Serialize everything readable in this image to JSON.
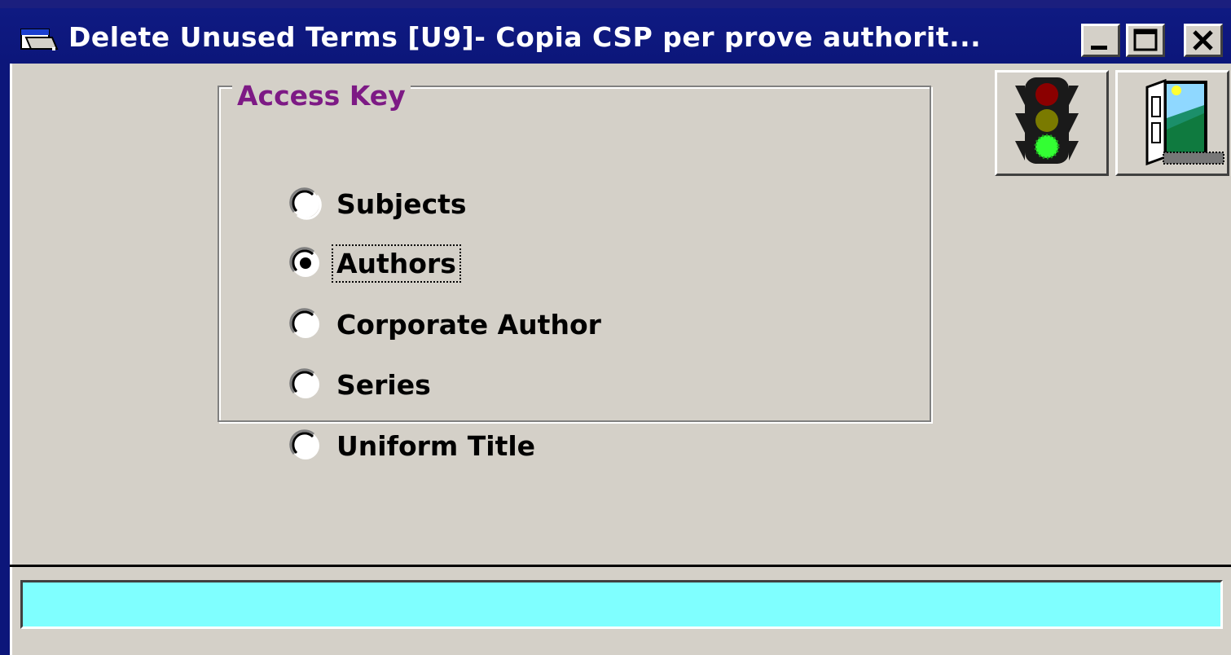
{
  "window": {
    "title": "Delete Unused Terms  [U9]- Copia CSP per prove authorit...",
    "icon": "folder-window-icon",
    "controls": [
      "minimize",
      "maximize",
      "close"
    ]
  },
  "toolbar": {
    "buttons": [
      {
        "name": "traffic-light-button",
        "icon": "traffic-light-icon"
      },
      {
        "name": "exit-button",
        "icon": "exit-door-icon"
      }
    ]
  },
  "access_key": {
    "legend": "Access Key",
    "selected": "Authors",
    "options": [
      {
        "label": "Subjects"
      },
      {
        "label": "Authors"
      },
      {
        "label": "Corporate Author"
      },
      {
        "label": "Series"
      },
      {
        "label": "Uniform Title"
      }
    ]
  },
  "status": {
    "text": "",
    "color": "#7fffff"
  },
  "colors": {
    "titlebar": "#0c167a",
    "legend": "#7d1a85",
    "face": "#d4d0c8"
  }
}
